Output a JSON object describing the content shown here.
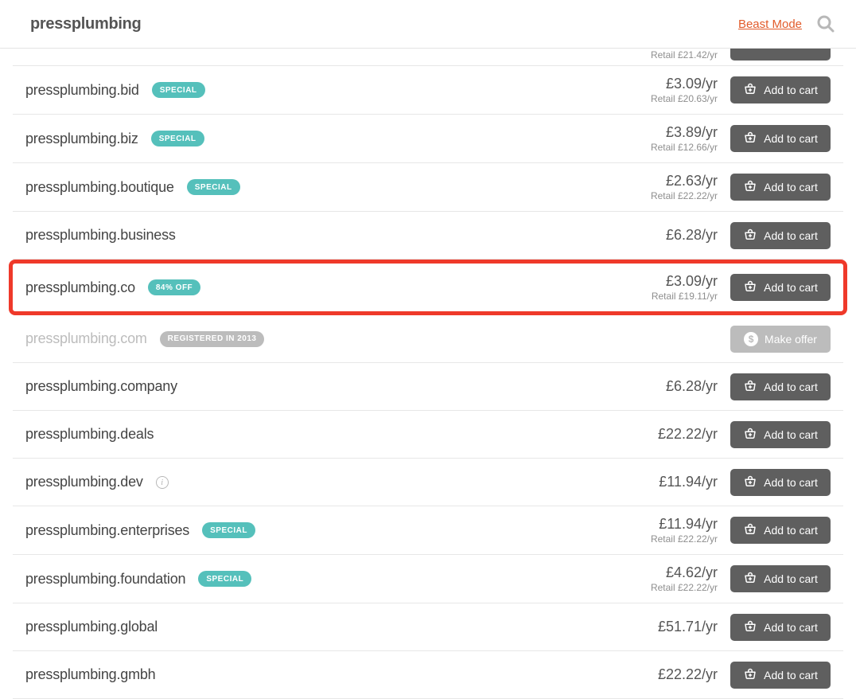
{
  "header": {
    "title": "pressplumbing",
    "beast_mode": "Beast Mode"
  },
  "partial": {
    "retail": "Retail £21.42/yr"
  },
  "buttons": {
    "add_to_cart": "Add to cart",
    "make_offer": "Make offer"
  },
  "rows": [
    {
      "domain": "pressplumbing.bid",
      "badge": "SPECIAL",
      "badge_style": "teal",
      "price": "£3.09/yr",
      "retail": "Retail £20.63/yr",
      "action": "add",
      "highlight": false
    },
    {
      "domain": "pressplumbing.biz",
      "badge": "SPECIAL",
      "badge_style": "teal",
      "price": "£3.89/yr",
      "retail": "Retail £12.66/yr",
      "action": "add",
      "highlight": false
    },
    {
      "domain": "pressplumbing.boutique",
      "badge": "SPECIAL",
      "badge_style": "teal",
      "price": "£2.63/yr",
      "retail": "Retail £22.22/yr",
      "action": "add",
      "highlight": false
    },
    {
      "domain": "pressplumbing.business",
      "badge": "",
      "badge_style": "",
      "price": "£6.28/yr",
      "retail": "",
      "action": "add",
      "highlight": false
    },
    {
      "domain": "pressplumbing.co",
      "badge": "84% OFF",
      "badge_style": "teal",
      "price": "£3.09/yr",
      "retail": "Retail £19.11/yr",
      "action": "add",
      "highlight": true
    },
    {
      "domain": "pressplumbing.com",
      "badge": "REGISTERED IN 2013",
      "badge_style": "grey",
      "price": "",
      "retail": "",
      "action": "offer",
      "muted": true,
      "highlight": false
    },
    {
      "domain": "pressplumbing.company",
      "badge": "",
      "badge_style": "",
      "price": "£6.28/yr",
      "retail": "",
      "action": "add",
      "highlight": false
    },
    {
      "domain": "pressplumbing.deals",
      "badge": "",
      "badge_style": "",
      "price": "£22.22/yr",
      "retail": "",
      "action": "add",
      "highlight": false
    },
    {
      "domain": "pressplumbing.dev",
      "badge": "",
      "badge_style": "",
      "price": "£11.94/yr",
      "retail": "",
      "action": "add",
      "info_icon": true,
      "highlight": false
    },
    {
      "domain": "pressplumbing.enterprises",
      "badge": "SPECIAL",
      "badge_style": "teal",
      "price": "£11.94/yr",
      "retail": "Retail £22.22/yr",
      "action": "add",
      "highlight": false
    },
    {
      "domain": "pressplumbing.foundation",
      "badge": "SPECIAL",
      "badge_style": "teal",
      "price": "£4.62/yr",
      "retail": "Retail £22.22/yr",
      "action": "add",
      "highlight": false
    },
    {
      "domain": "pressplumbing.global",
      "badge": "",
      "badge_style": "",
      "price": "£51.71/yr",
      "retail": "",
      "action": "add",
      "highlight": false
    },
    {
      "domain": "pressplumbing.gmbh",
      "badge": "",
      "badge_style": "",
      "price": "£22.22/yr",
      "retail": "",
      "action": "add",
      "highlight": false
    }
  ]
}
